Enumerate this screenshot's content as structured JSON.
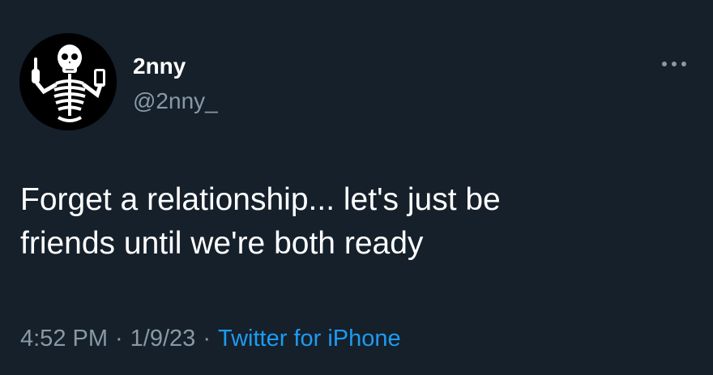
{
  "colors": {
    "background": "#15202b",
    "primary_text": "#ffffff",
    "secondary_text": "#8899a6",
    "link": "#1d9bf0"
  },
  "author": {
    "avatar_icon": "skeleton-avatar-icon",
    "display_name": "2nny",
    "handle": "@2nny_"
  },
  "more_icon": "more-options-icon",
  "tweet": {
    "text": "Forget a relationship... let's just be\nfriends until we're both ready"
  },
  "meta": {
    "time": "4:52 PM",
    "separator": "·",
    "date": "1/9/23",
    "source": "Twitter for iPhone"
  }
}
